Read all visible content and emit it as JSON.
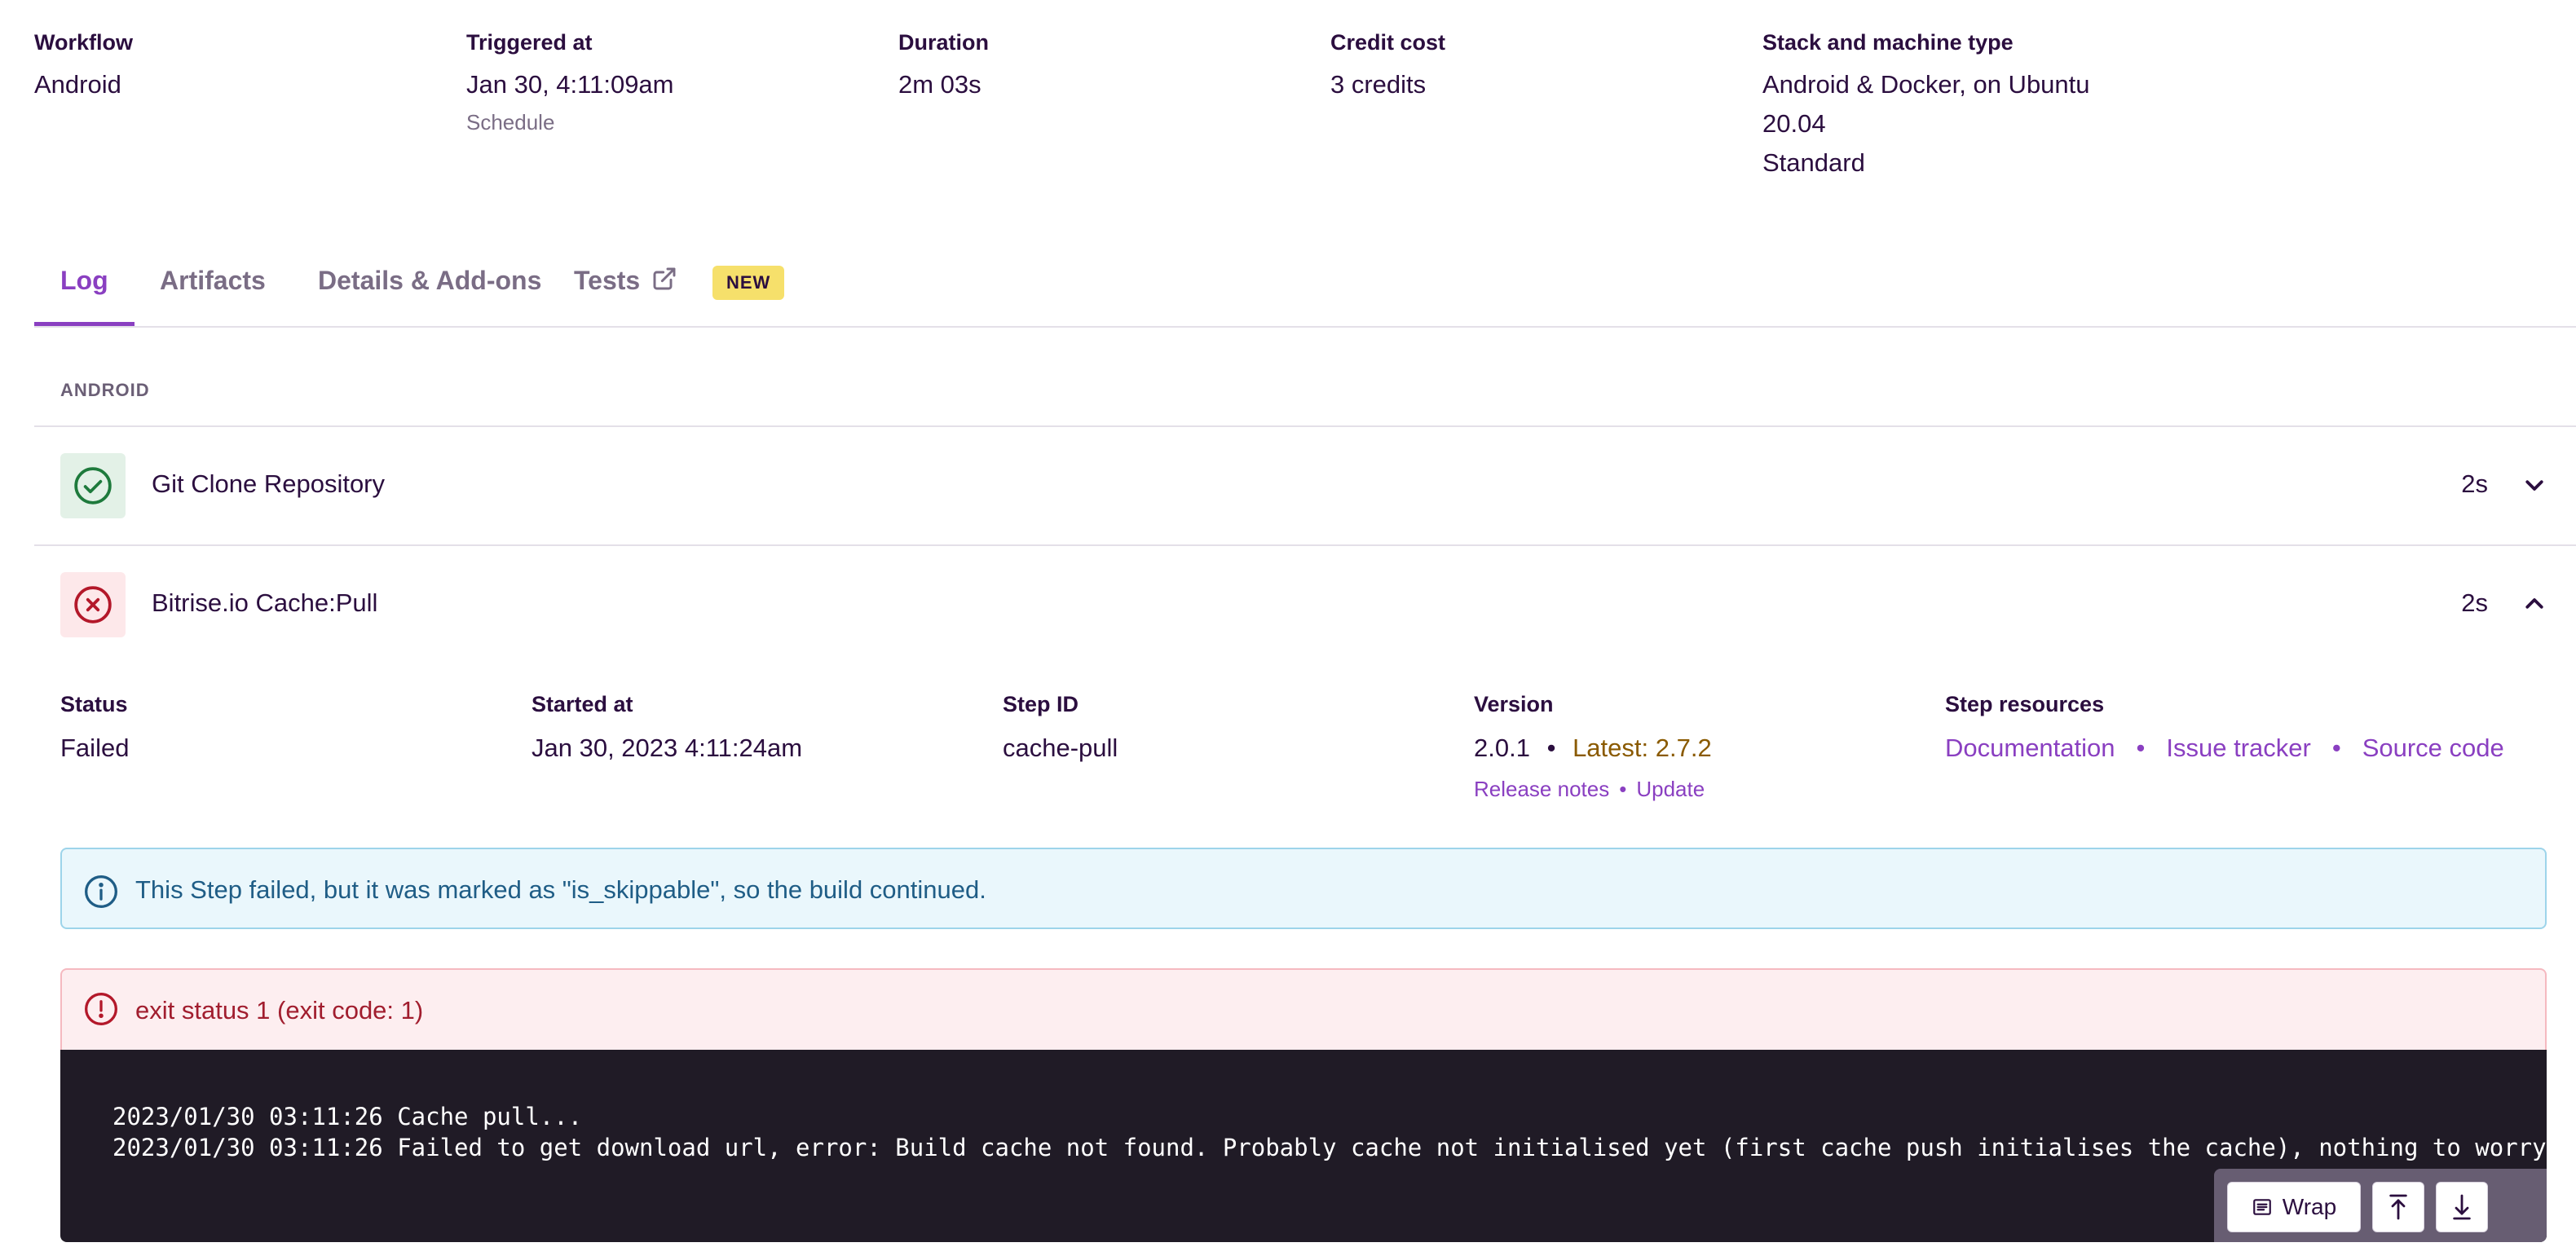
{
  "meta": {
    "workflow": {
      "label": "Workflow",
      "value": "Android"
    },
    "triggered": {
      "label": "Triggered at",
      "value": "Jan 30, 4:11:09am",
      "sub": "Schedule"
    },
    "duration": {
      "label": "Duration",
      "value": "2m 03s"
    },
    "credit": {
      "label": "Credit cost",
      "value": "3 credits"
    },
    "stack": {
      "label": "Stack and machine type",
      "line1": "Android & Docker, on Ubuntu",
      "line2": "20.04",
      "line3": "Standard"
    }
  },
  "tabs": [
    {
      "label": "Log",
      "active": true
    },
    {
      "label": "Artifacts"
    },
    {
      "label": "Details & Add-ons"
    },
    {
      "label": "Tests",
      "icon": "external-link-icon"
    }
  ],
  "badge_new": "NEW",
  "section_label": "ANDROID",
  "steps": [
    {
      "title": "Git Clone Repository",
      "time": "2s",
      "status_icon": "check-circle-icon",
      "chevron": "chevron-down-icon"
    },
    {
      "title": "Bitrise.io Cache:Pull",
      "time": "2s",
      "status_icon": "x-circle-icon",
      "chevron": "chevron-up-icon"
    }
  ],
  "detail": {
    "status": {
      "label": "Status",
      "value": "Failed"
    },
    "started": {
      "label": "Started at",
      "value": "Jan 30, 2023 4:11:24am"
    },
    "step_id": {
      "label": "Step ID",
      "value": "cache-pull"
    },
    "version": {
      "label": "Version",
      "current": "2.0.1",
      "separator": "•",
      "latest": "Latest: 2.7.2",
      "release_notes": "Release notes",
      "update": "Update"
    },
    "resources": {
      "label": "Step resources",
      "documentation": "Documentation",
      "issue_tracker": "Issue tracker",
      "source_code": "Source code"
    }
  },
  "info_message": "This Step failed, but it was marked as \"is_skippable\", so the build continued.",
  "error_message": "exit status 1 (exit code: 1)",
  "log_lines": [
    "2023/01/30 03:11:26 Cache pull...",
    "2023/01/30 03:11:26 Failed to get download url, error: Build cache not found. Probably cache not initialised yet (first cache push initialises the cache), nothing to worry about ;)"
  ],
  "log_tools": {
    "wrap": "Wrap",
    "scroll_top_icon": "arrow-up-icon",
    "scroll_bottom_icon": "arrow-down-icon"
  },
  "colors": {
    "accent": "#8a3fc1",
    "success": "#1e7a3c",
    "error": "#b3182a",
    "info": "#1f5d86",
    "badge": "#f6e06b",
    "log_bg": "#201b26"
  }
}
